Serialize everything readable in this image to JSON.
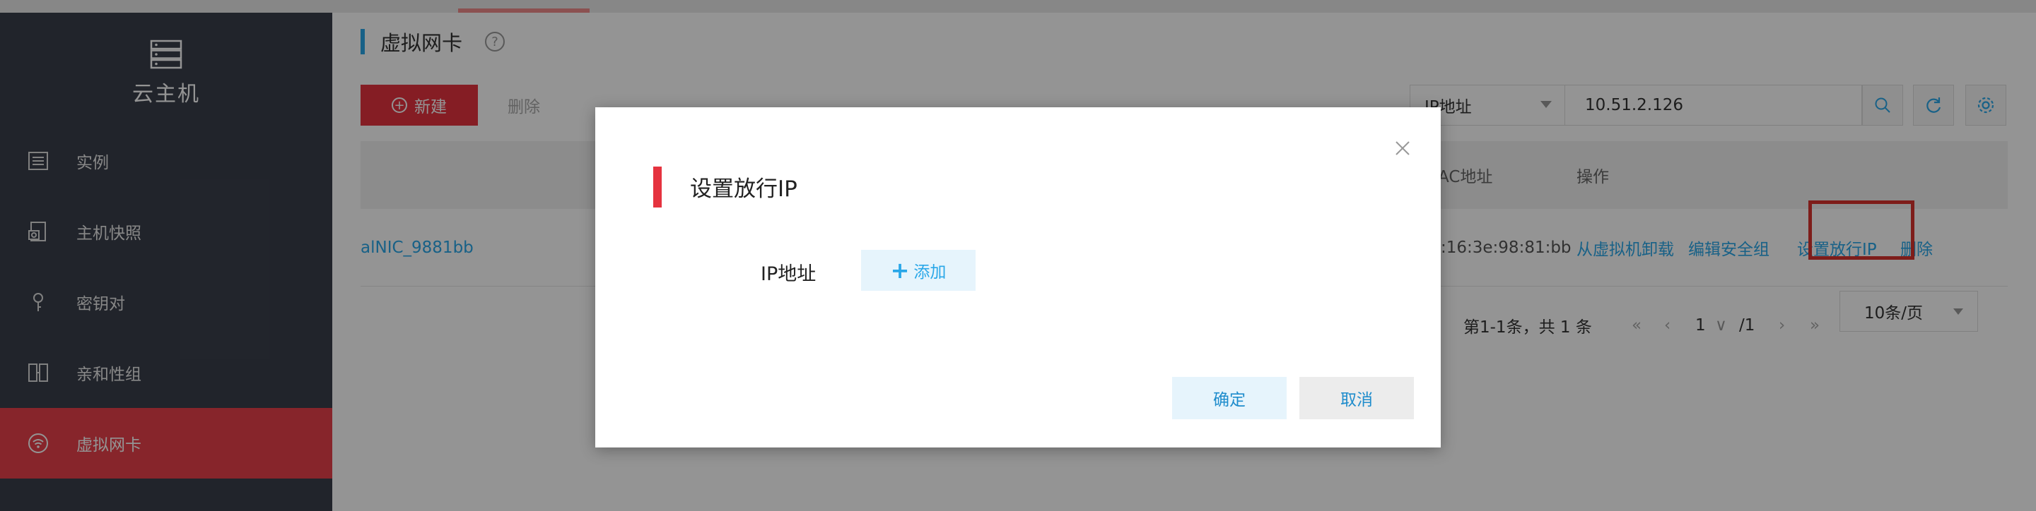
{
  "sidebar": {
    "brand_title": "云主机",
    "items": [
      {
        "label": "实例",
        "icon": "list-icon"
      },
      {
        "label": "主机快照",
        "icon": "snapshot-icon"
      },
      {
        "label": "密钥对",
        "icon": "key-icon"
      },
      {
        "label": "亲和性组",
        "icon": "group-icon"
      },
      {
        "label": "虚拟网卡",
        "icon": "wifi-icon",
        "active": true
      }
    ]
  },
  "header": {
    "title": "虚拟网卡",
    "help": "?"
  },
  "toolbar": {
    "new_label": "新建",
    "delete_label": "删除",
    "search_field": "IP地址",
    "search_value": "10.51.2.126"
  },
  "table": {
    "columns": [
      "AC地址",
      "操作"
    ],
    "row": {
      "name": "alNIC_9881bb",
      "mac": ":16:3e:98:81:bb",
      "actions": [
        "从虚拟机卸载",
        "编辑安全组",
        "设置放行IP",
        "删除"
      ]
    }
  },
  "pagination": {
    "summary": "第1-1条，共 1 条",
    "current": "1",
    "total": "/1",
    "page_size": "10条/页"
  },
  "modal": {
    "title": "设置放行IP",
    "field_label": "IP地址",
    "add_label": "添加",
    "ok_label": "确定",
    "cancel_label": "取消"
  },
  "colors": {
    "accent_red": "#e5333f",
    "link_blue": "#2aa7e8",
    "highlight_border": "#d9332e"
  }
}
